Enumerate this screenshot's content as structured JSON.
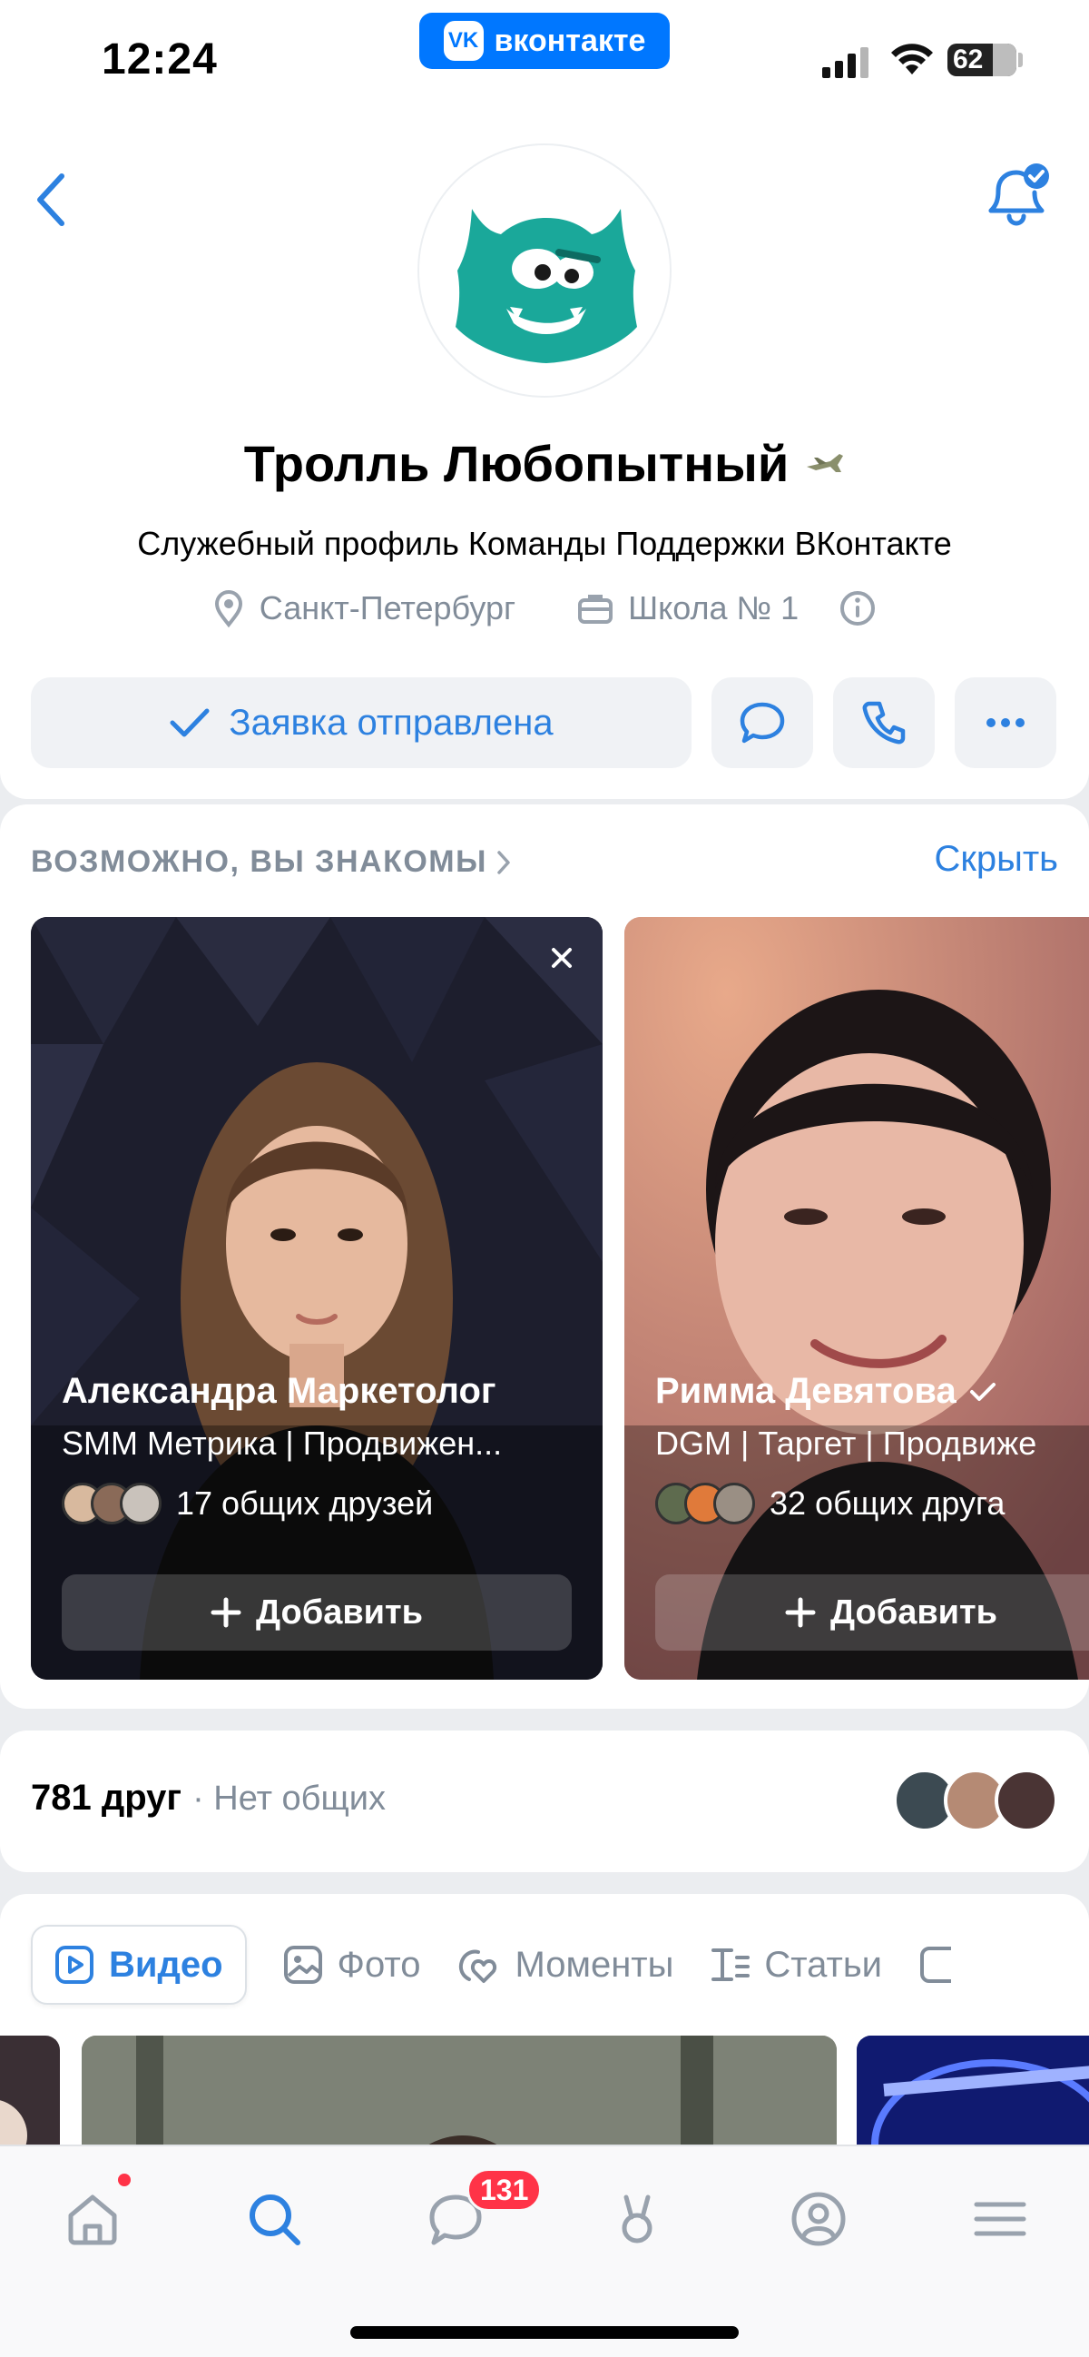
{
  "status_bar": {
    "time": "12:24",
    "app_pill": "вконтакте",
    "battery": "62"
  },
  "profile": {
    "name": "Тролль Любопытный",
    "status": "Служебный профиль Команды Поддержки ВКонтакте",
    "city": "Санкт-Петербург",
    "school": "Школа № 1",
    "request_button": "Заявка отправлена",
    "accent_color": "#2d81e0"
  },
  "suggestions": {
    "title": "ВОЗМОЖНО, ВЫ ЗНАКОМЫ",
    "hide": "Скрыть",
    "people": [
      {
        "name": "Александра Маркетолог",
        "job": "SMM Метрика | Продвижен...",
        "mutual": "17 общих друзей",
        "add": "Добавить"
      },
      {
        "name": "Римма Девятова",
        "job": "DGM  | Таргет | Продвиже",
        "mutual": "32 общих друга",
        "add": "Добавить"
      }
    ]
  },
  "friends": {
    "count": "781 друг",
    "sub": "· Нет общих"
  },
  "content_tabs": [
    {
      "label": "Видео",
      "icon": "video-icon"
    },
    {
      "label": "Фото",
      "icon": "photo-icon"
    },
    {
      "label": "Моменты",
      "icon": "moments-icon"
    },
    {
      "label": "Статьи",
      "icon": "articles-icon"
    }
  ],
  "tabbar": {
    "messages_badge": "131"
  }
}
